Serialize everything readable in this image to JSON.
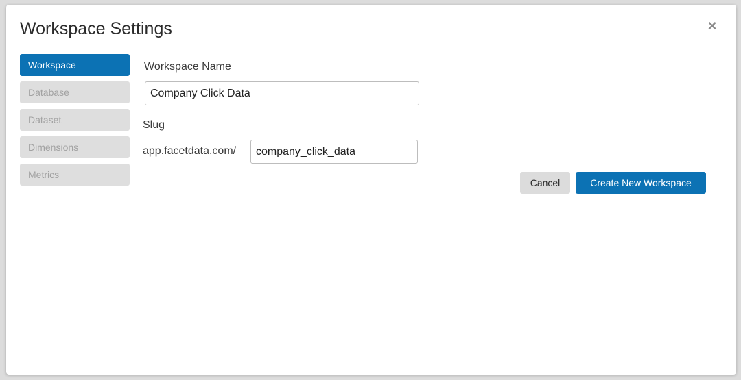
{
  "dialog": {
    "title": "Workspace Settings",
    "close_icon": "close-icon",
    "close_glyph": "×"
  },
  "sidebar": {
    "items": [
      {
        "label": "Workspace",
        "active": true
      },
      {
        "label": "Database",
        "active": false
      },
      {
        "label": "Dataset",
        "active": false
      },
      {
        "label": "Dimensions",
        "active": false
      },
      {
        "label": "Metrics",
        "active": false
      }
    ]
  },
  "form": {
    "workspace_name_label": "Workspace Name",
    "workspace_name_value": "Company Click Data",
    "slug_label": "Slug",
    "slug_prefix": "app.facetdata.com/",
    "slug_value": "company_click_data"
  },
  "actions": {
    "cancel_label": "Cancel",
    "create_label": "Create New Workspace"
  },
  "colors": {
    "accent": "#0c72b4",
    "inactive_tab_bg": "#dedede",
    "inactive_tab_text": "#a2a2a2"
  }
}
